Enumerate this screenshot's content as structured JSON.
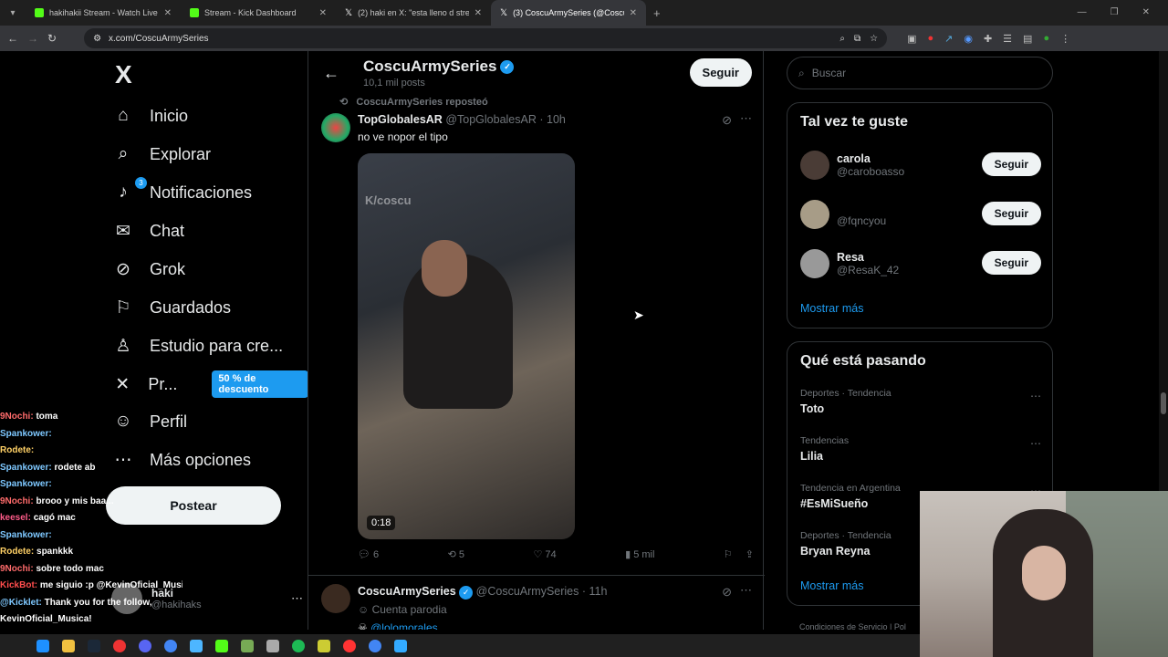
{
  "browser": {
    "tabs": [
      {
        "title": "hakihakii Stream - Watch Live o",
        "color": "#53fc18"
      },
      {
        "title": "Stream - Kick Dashboard",
        "color": "#53fc18"
      },
      {
        "title": "(2) haki en X: \"esta lleno d stre",
        "color": "#ffffff"
      },
      {
        "title": "(3) CoscuArmySeries (@Coscu",
        "color": "#ffffff"
      }
    ],
    "url": "x.com/CoscuArmySeries"
  },
  "nav": {
    "logo": "X",
    "items": [
      {
        "label": "Inicio",
        "icon": "home-icon",
        "glyph": "⌂"
      },
      {
        "label": "Explorar",
        "icon": "search-icon",
        "glyph": "⌕"
      },
      {
        "label": "Notificaciones",
        "icon": "bell-icon",
        "glyph": "🔔︎",
        "badge": "3"
      },
      {
        "label": "Chat",
        "icon": "mail-icon",
        "glyph": "✉"
      },
      {
        "label": "Grok",
        "icon": "grok-icon",
        "glyph": "⊘"
      },
      {
        "label": "Guardados",
        "icon": "bookmark-icon",
        "glyph": "⚐"
      },
      {
        "label": "Estudio para cre...",
        "icon": "studio-icon",
        "glyph": "♙"
      },
      {
        "label": "Pr...",
        "icon": "x-premium-icon",
        "glyph": "✕",
        "promo": "50 % de descuento"
      },
      {
        "label": "Perfil",
        "icon": "profile-icon",
        "glyph": "☺"
      },
      {
        "label": "Más opciones",
        "icon": "more-options-icon",
        "glyph": "⋯"
      }
    ],
    "post_button": "Postear",
    "account": {
      "name": "haki",
      "handle": "@hakihaks"
    }
  },
  "stream_chat": [
    {
      "user": "9Nochi:",
      "msg": "toma",
      "color": "#ff6b6b"
    },
    {
      "user": "Spankower:",
      "msg": "",
      "color": "#7ec8ff"
    },
    {
      "user": "Rodete:",
      "msg": "",
      "color": "#ffd166"
    },
    {
      "user": "Spankower:",
      "msg": "rodete ab",
      "color": "#7ec8ff"
    },
    {
      "user": "Spankower:",
      "msg": "",
      "color": "#7ec8ff"
    },
    {
      "user": "9Nochi:",
      "msg": "brooo y mis baa...",
      "color": "#ff6b6b"
    },
    {
      "user": "keesel:",
      "msg": "cagó mac",
      "color": "#ff5c8a"
    },
    {
      "user": "Spankower:",
      "msg": "",
      "color": "#7ec8ff"
    },
    {
      "user": "Rodete:",
      "msg": "spankkk",
      "color": "#ffd166"
    },
    {
      "user": "9Nochi:",
      "msg": "sobre todo mac",
      "color": "#ff6b6b"
    },
    {
      "user": "KickBot:",
      "msg": "me siguio :p @KevinOficial_Musica",
      "color": "#ff4d4d"
    },
    {
      "user": "@Kicklet:",
      "msg": "Thank you for the follow,",
      "color": "#7ec8ff"
    },
    {
      "user": "",
      "msg": "KevinOficial_Musica!",
      "color": "#ffffff"
    }
  ],
  "profile": {
    "name": "CoscuArmySeries",
    "posts_count": "10,1 mil posts",
    "follow_label": "Seguir"
  },
  "tweets": [
    {
      "repost_note": "CoscuArmySeries reposteó",
      "author": "TopGlobalesAR",
      "handle": "@TopGlobalesAR",
      "time": "· 10h",
      "text": "no ve nopor el tipo",
      "video_duration": "0:18",
      "video_watermark": "K/coscu",
      "replies": "6",
      "reposts": "5",
      "likes": "74",
      "views": "5 mil"
    },
    {
      "author": "CoscuArmySeries",
      "handle": "@CoscuArmySeries",
      "time": "· 11h",
      "line1": "Cuenta parodia",
      "line2": "@lolomorales"
    }
  ],
  "sidebar": {
    "search_placeholder": "Buscar",
    "who_to_follow": {
      "title": "Tal vez te guste",
      "users": [
        {
          "name": "carola",
          "handle": "@caroboasso",
          "follow": "Seguir"
        },
        {
          "name": "",
          "handle": "@fqncyou",
          "follow": "Seguir"
        },
        {
          "name": "Resa",
          "handle": "@ResaK_42",
          "follow": "Seguir"
        }
      ],
      "more": "Mostrar más"
    },
    "trends": {
      "title": "Qué está pasando",
      "items": [
        {
          "meta": "Deportes · Tendencia",
          "topic": "Toto"
        },
        {
          "meta": "Tendencias",
          "topic": "Lilia"
        },
        {
          "meta": "Tendencia en Argentina",
          "topic": "#EsMiSueño"
        },
        {
          "meta": "Deportes · Tendencia",
          "topic": "Bryan Reyna"
        }
      ],
      "more": "Mostrar más"
    },
    "footer": "Condiciones de Servicio  |  Pol"
  }
}
